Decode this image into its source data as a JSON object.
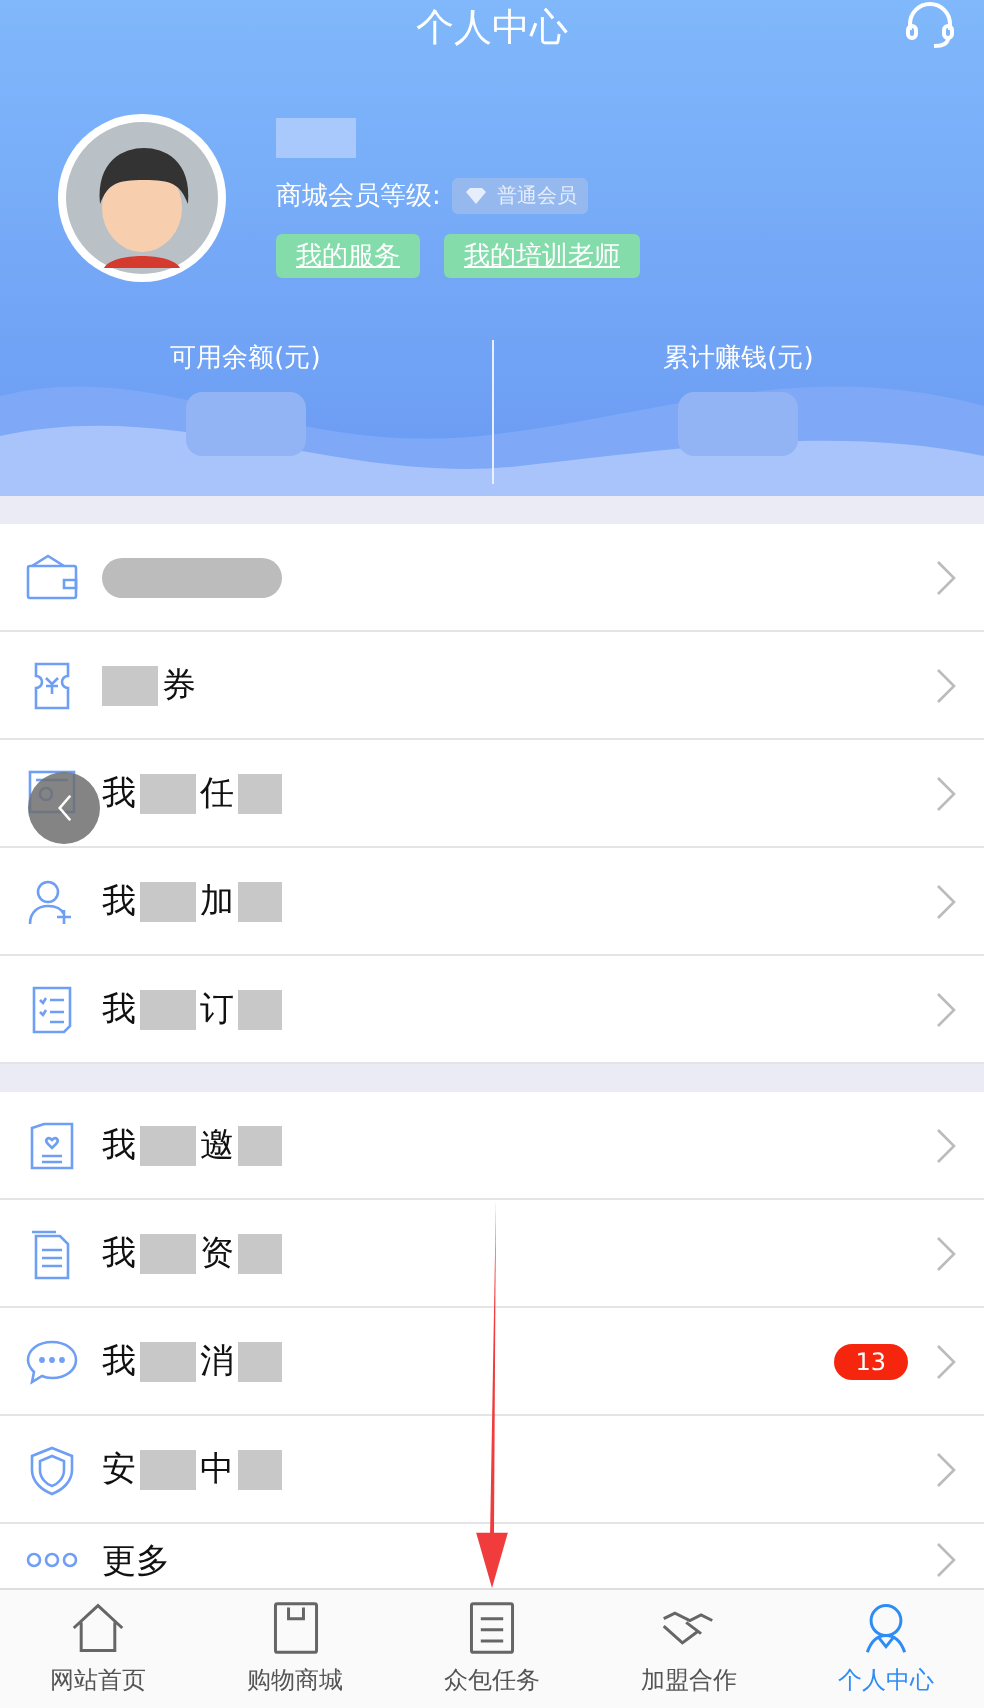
{
  "header": {
    "title": "个人中心",
    "member_label": "商城会员等级:",
    "member_badge": "普通会员",
    "buttons": [
      "我的服务",
      "我的培训老师"
    ],
    "stats": [
      {
        "label": "可用余额(元)"
      },
      {
        "label": "累计赚钱(元)"
      }
    ]
  },
  "menu_groups": [
    [
      {
        "kind": "wallet"
      },
      {
        "kind": "coupon",
        "tail": "券"
      },
      {
        "kind": "certificate",
        "lead": "我",
        "tail": "任"
      },
      {
        "kind": "useradd",
        "lead": "我",
        "tail": "加"
      },
      {
        "kind": "checklist",
        "lead": "我",
        "tail": "订"
      }
    ],
    [
      {
        "kind": "card",
        "lead": "我",
        "tail": "邀"
      },
      {
        "kind": "document",
        "lead": "我",
        "tail": "资"
      },
      {
        "kind": "chat",
        "lead": "我",
        "tail": "消",
        "badge": "13"
      },
      {
        "kind": "shield",
        "lead": "安",
        "tail": "中"
      },
      {
        "kind": "more",
        "title": "更多"
      }
    ]
  ],
  "tabs": [
    {
      "label": "网站首页",
      "selected": false
    },
    {
      "label": "购物商城",
      "selected": false
    },
    {
      "label": "众包任务",
      "selected": false
    },
    {
      "label": "加盟合作",
      "selected": false
    },
    {
      "label": "个人中心",
      "selected": true
    }
  ]
}
